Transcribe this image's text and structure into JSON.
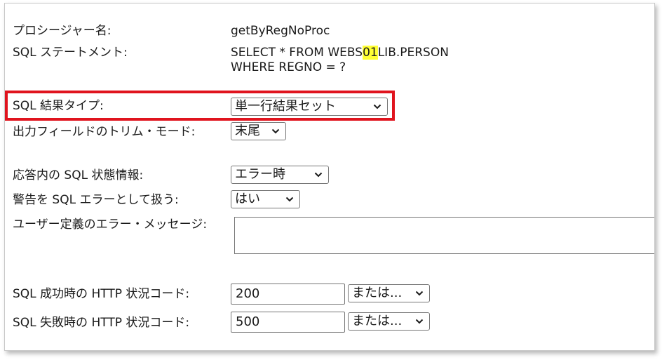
{
  "procedure": {
    "label": "プロシージャー名:",
    "value": "getByRegNoProc"
  },
  "sql_statement": {
    "label": "SQL ステートメント:",
    "line1_before": "SELECT * FROM WEBS",
    "line1_highlight": "01",
    "line1_after": "LIB.PERSON",
    "line2": "WHERE REGNO = ?"
  },
  "result_type": {
    "label": "SQL 結果タイプ:",
    "selected": "単一行結果セット"
  },
  "trim_mode": {
    "label": "出力フィールドのトリム・モード:",
    "selected": "末尾"
  },
  "sql_state": {
    "label": "応答内の SQL 状態情報:",
    "selected": "エラー時"
  },
  "warning": {
    "label": "警告を SQL エラーとして扱う:",
    "selected": "はい"
  },
  "user_message": {
    "label": "ユーザー定義のエラー・メッセージ:",
    "value": ""
  },
  "http_success": {
    "label": "SQL 成功時の HTTP 状況コード:",
    "value": "200",
    "or_selected": "または..."
  },
  "http_failure": {
    "label": "SQL 失敗時の HTTP 状況コード:",
    "value": "500",
    "or_selected": "または..."
  },
  "colors": {
    "highlight": "#ffff33",
    "annotation_border": "#e0141e"
  }
}
